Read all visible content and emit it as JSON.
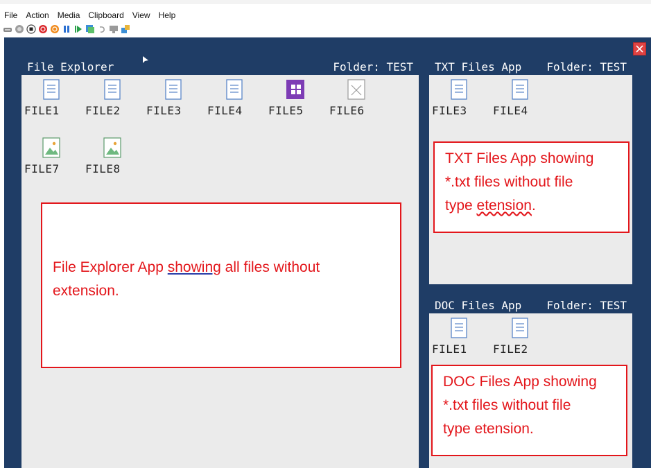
{
  "menu": [
    "File",
    "Action",
    "Media",
    "Clipboard",
    "View",
    "Help"
  ],
  "toolbar_icons": [
    "ctrl-alt-del-icon",
    "start-icon",
    "turn-off-icon",
    "shut-down-icon",
    "save-state-icon",
    "pause-icon",
    "resume-icon",
    "checkpoint-icon",
    "revert-icon",
    "enhanced-session-icon",
    "share-icon"
  ],
  "file_explorer": {
    "title": "File Explorer",
    "folder": "Folder: TEST",
    "files": [
      {
        "name": "FILE1",
        "icon": "document-icon"
      },
      {
        "name": "FILE2",
        "icon": "document-icon"
      },
      {
        "name": "FILE3",
        "icon": "document-icon"
      },
      {
        "name": "FILE4",
        "icon": "document-icon"
      },
      {
        "name": "FILE5",
        "icon": "app-grid-icon"
      },
      {
        "name": "FILE6",
        "icon": "broken-file-icon"
      },
      {
        "name": "FILE7",
        "icon": "image-icon"
      },
      {
        "name": "FILE8",
        "icon": "image-icon"
      }
    ]
  },
  "txt_app": {
    "title": "TXT Files App",
    "folder": "Folder: TEST",
    "files": [
      {
        "name": "FILE3",
        "icon": "document-icon"
      },
      {
        "name": "FILE4",
        "icon": "document-icon"
      }
    ]
  },
  "doc_app": {
    "title": "DOC Files App",
    "folder": "Folder: TEST",
    "files": [
      {
        "name": "FILE1",
        "icon": "document-icon"
      },
      {
        "name": "FILE2",
        "icon": "document-icon"
      }
    ]
  },
  "notes": {
    "explorer": {
      "line1_a": "File Explorer App ",
      "line1_b": "showing",
      "line1_c": " all files without",
      "line2": "extension."
    },
    "txt": {
      "line1": "TXT Files App showing",
      "line2": "*.txt files without file",
      "line3_a": "type ",
      "line3_b": "etension",
      "line3_c": "."
    },
    "doc": {
      "line1": "DOC Files App showing",
      "line2": "*.txt files without file",
      "line3": "type etension."
    }
  },
  "colors": {
    "screen_bg": "#1f3d66",
    "window_bg": "#ebebeb",
    "annotation": "#e3161b",
    "close_button": "#e04343"
  }
}
